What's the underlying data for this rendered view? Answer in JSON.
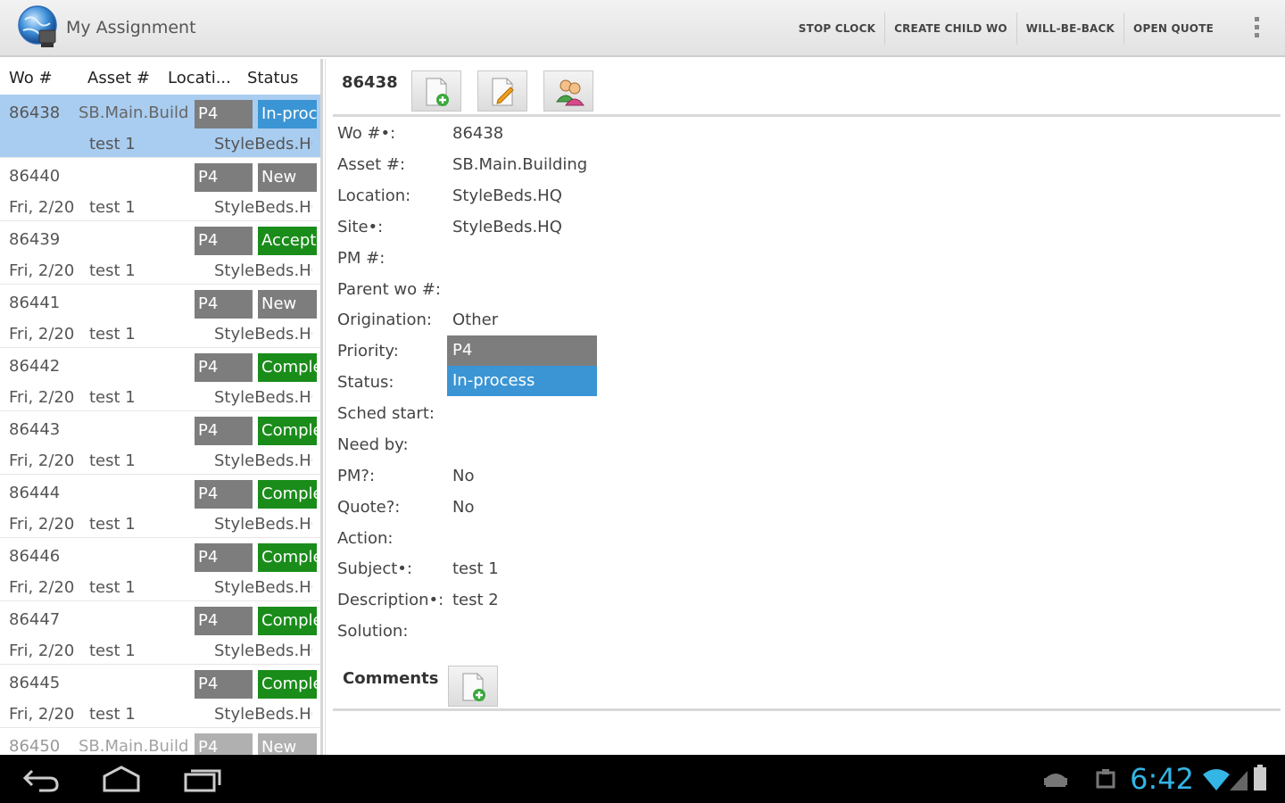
{
  "app": {
    "title": "My Assignment",
    "actions": [
      "STOP CLOCK",
      "CREATE CHILD WO",
      "WILL-BE-BACK",
      "OPEN QUOTE"
    ]
  },
  "list": {
    "headers": [
      "Wo #",
      "Asset #",
      "Locati...",
      "Status"
    ],
    "rows": [
      {
        "wo": "86438",
        "asset": "SB.Main.Building",
        "priority": "P4",
        "status": "In-process",
        "date": "",
        "subject": "test 1",
        "location": "StyleBeds.HQ"
      },
      {
        "wo": "86440",
        "asset": "",
        "priority": "P4",
        "status": "New",
        "date": "Fri, 2/20",
        "subject": "test 1",
        "location": "StyleBeds.HQ"
      },
      {
        "wo": "86439",
        "asset": "",
        "priority": "P4",
        "status": "Accepted",
        "date": "Fri, 2/20",
        "subject": "test 1",
        "location": "StyleBeds.HQ"
      },
      {
        "wo": "86441",
        "asset": "",
        "priority": "P4",
        "status": "New",
        "date": "Fri, 2/20",
        "subject": "test 1",
        "location": "StyleBeds.HQ"
      },
      {
        "wo": "86442",
        "asset": "",
        "priority": "P4",
        "status": "Completed",
        "date": "Fri, 2/20",
        "subject": "test 1",
        "location": "StyleBeds.HQ"
      },
      {
        "wo": "86443",
        "asset": "",
        "priority": "P4",
        "status": "Completed",
        "date": "Fri, 2/20",
        "subject": "test 1",
        "location": "StyleBeds.HQ"
      },
      {
        "wo": "86444",
        "asset": "",
        "priority": "P4",
        "status": "Completed",
        "date": "Fri, 2/20",
        "subject": "test 1",
        "location": "StyleBeds.HQ"
      },
      {
        "wo": "86446",
        "asset": "",
        "priority": "P4",
        "status": "Completed",
        "date": "Fri, 2/20",
        "subject": "test 1",
        "location": "StyleBeds.HQ"
      },
      {
        "wo": "86447",
        "asset": "",
        "priority": "P4",
        "status": "Completed",
        "date": "Fri, 2/20",
        "subject": "test 1",
        "location": "StyleBeds.HQ"
      },
      {
        "wo": "86445",
        "asset": "",
        "priority": "P4",
        "status": "Completed",
        "date": "Fri, 2/20",
        "subject": "test 1",
        "location": "StyleBeds.HQ"
      },
      {
        "wo": "86450",
        "asset": "SB.Main.Building",
        "priority": "P4",
        "status": "New",
        "date": "",
        "subject": "",
        "location": ""
      }
    ]
  },
  "detail": {
    "wo_number": "86438",
    "fields": [
      {
        "label": "Wo #•:",
        "value": "86438"
      },
      {
        "label": "Asset #:",
        "value": "SB.Main.Building"
      },
      {
        "label": "Location:",
        "value": "StyleBeds.HQ"
      },
      {
        "label": "Site•:",
        "value": "StyleBeds.HQ"
      },
      {
        "label": "PM #:",
        "value": ""
      },
      {
        "label": "Parent wo #:",
        "value": ""
      },
      {
        "label": "Origination:",
        "value": "Other"
      },
      {
        "label": "Priority:",
        "value": "P4"
      },
      {
        "label": "Status:",
        "value": "In-process"
      },
      {
        "label": "Sched start:",
        "value": ""
      },
      {
        "label": "Need by:",
        "value": ""
      },
      {
        "label": "PM?:",
        "value": "No"
      },
      {
        "label": "Quote?:",
        "value": "No"
      },
      {
        "label": "Action:",
        "value": ""
      },
      {
        "label": "Subject•:",
        "value": "test 1"
      },
      {
        "label": "Description•:",
        "value": "test 2"
      },
      {
        "label": "Solution:",
        "value": ""
      }
    ],
    "comments_label": "Comments"
  },
  "system": {
    "clock": "6:42"
  },
  "colors": {
    "accent": "#33b5e5",
    "selected_row": "#a9cdf0",
    "status_blue": "#3b95d4",
    "status_green": "#1a8c1a",
    "badge_gray": "#7d7d7d"
  }
}
